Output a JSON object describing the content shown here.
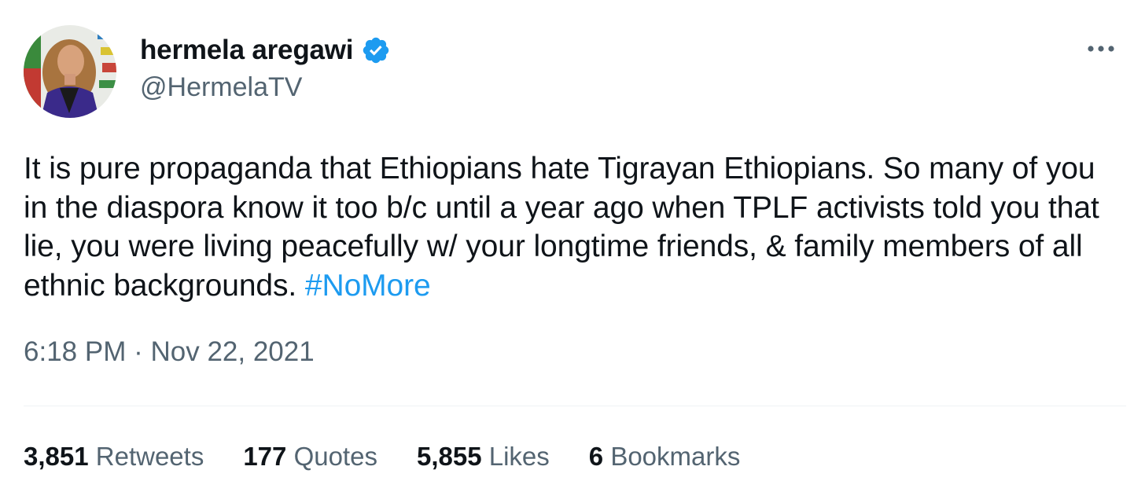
{
  "author": {
    "display_name": "hermela aregawi",
    "handle": "@HermelaTV",
    "verified": true
  },
  "tweet": {
    "text": "It is pure propaganda that Ethiopians hate Tigrayan Ethiopians. So many of you in the diaspora know it too b/c until a year ago when TPLF activists told you that lie, you were living peacefully w/ your longtime friends, & family members of all ethnic backgrounds.",
    "hashtag": "#NoMore",
    "time": "6:18 PM",
    "separator": "·",
    "date": "Nov 22, 2021"
  },
  "stats": [
    {
      "count": "3,851",
      "label": "Retweets"
    },
    {
      "count": "177",
      "label": "Quotes"
    },
    {
      "count": "5,855",
      "label": "Likes"
    },
    {
      "count": "6",
      "label": "Bookmarks"
    }
  ],
  "icons": {
    "verified": "verified-badge-icon",
    "more": "more-options-icon"
  },
  "colors": {
    "text_primary": "#0f1419",
    "text_secondary": "#536471",
    "link": "#1d9bf0",
    "divider": "#eff3f4"
  }
}
